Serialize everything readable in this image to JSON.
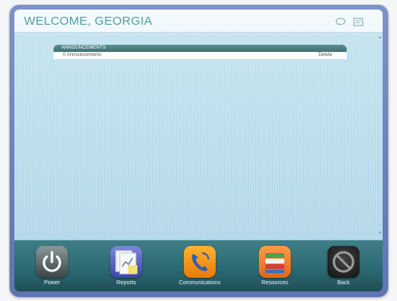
{
  "header": {
    "title": "WELCOME, GEORGIA"
  },
  "announcements": {
    "header_label": "ANNOUNCEMENTS",
    "row_count_text": "0 Announcements",
    "row_action": "Delete"
  },
  "dock": {
    "buttons": [
      {
        "label": "Power"
      },
      {
        "label": "Reports"
      },
      {
        "label": "Communications"
      },
      {
        "label": "Resources"
      },
      {
        "label": "Back"
      }
    ]
  }
}
